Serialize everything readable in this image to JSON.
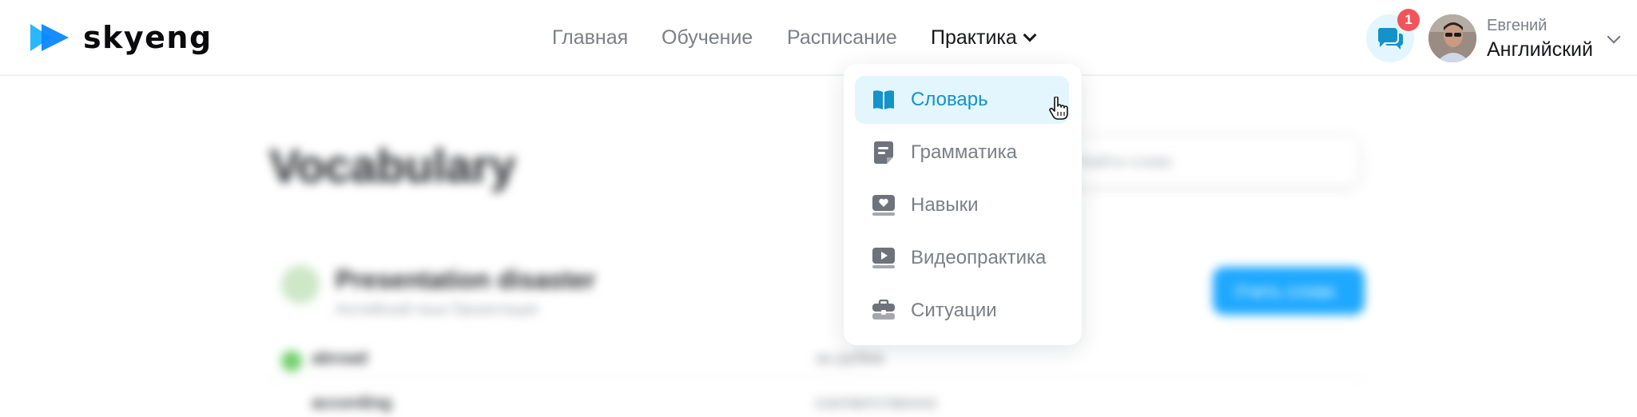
{
  "brand": {
    "name": "skyeng",
    "accent": "#1ea8ff",
    "logo_icon": "play-triangles-icon"
  },
  "nav": {
    "items": [
      {
        "label": "Главная"
      },
      {
        "label": "Обучение"
      },
      {
        "label": "Расписание"
      },
      {
        "label": "Практика",
        "active": true,
        "icon": "chevron-down-icon"
      }
    ]
  },
  "header_right": {
    "chat_icon": "chat-bubbles-icon",
    "notification_count": "1",
    "user": {
      "first_name": "Евгений",
      "course": "Английский"
    }
  },
  "dropdown": {
    "items": [
      {
        "label": "Словарь",
        "icon": "book-icon",
        "selected": true
      },
      {
        "label": "Грамматика",
        "icon": "document-icon"
      },
      {
        "label": "Навыки",
        "icon": "heart-screen-icon"
      },
      {
        "label": "Видеопрактика",
        "icon": "play-screen-icon"
      },
      {
        "label": "Ситуации",
        "icon": "suitcase-icon"
      }
    ],
    "selected_color": "#1492c9",
    "selected_bg": "#e3f6fd"
  },
  "background_page": {
    "title": "Vocabulary",
    "search_placeholder": "Найти слово",
    "card_title": "Presentation disaster",
    "card_subtitle": "Английский язык Презентация",
    "card_button": "Учить слова",
    "rows": [
      {
        "left": "abroad",
        "right": "за рубеж"
      },
      {
        "left": "according",
        "right": "соответственно"
      }
    ]
  }
}
